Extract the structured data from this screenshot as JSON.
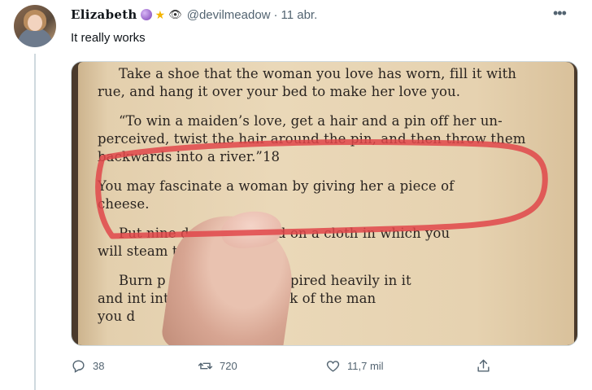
{
  "tweet": {
    "display_name": "Elizabeth",
    "handle": "@devilmeadow",
    "separator": "·",
    "date": "11 abr.",
    "text": "It really works",
    "more_icon": "more-dots-icon"
  },
  "media": {
    "book_lines": [
      "Take a shoe that the woman you love has worn, fill it with",
      "rue, and hang it over your bed to make her love you.",
      "“To win a maiden’s love, get a hair and a pin off her un-",
      "perceived, twist the hair around the pin, and then throw them",
      "backwards into a river.”18",
      "You may fascinate a woman by giving her a piece of",
      "cheese.",
      "Put nine dro          fresh blood on a cloth in which you",
      "will steam th         one you love.",
      "Burn p               ter you have perspired heavily in it",
      "and int               into the food or drink of the man",
      "you d"
    ],
    "highlight_color": "#e0464a"
  },
  "actions": {
    "reply": {
      "icon": "reply-icon",
      "count": "38"
    },
    "retweet": {
      "icon": "retweet-icon",
      "count": "720"
    },
    "like": {
      "icon": "heart-icon",
      "count": "11,7 mil"
    },
    "share": {
      "icon": "share-icon"
    }
  }
}
